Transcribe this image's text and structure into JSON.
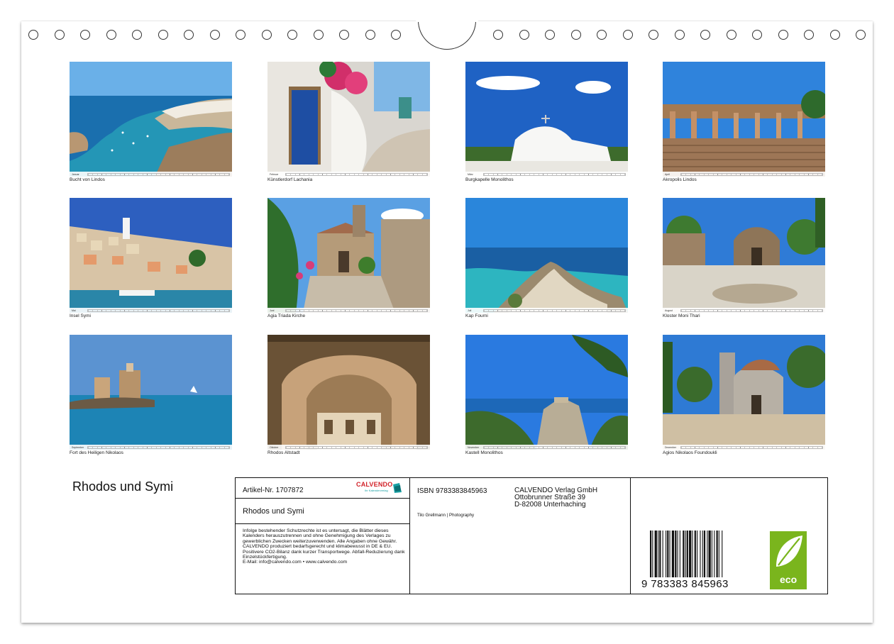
{
  "photos": [
    {
      "month": "Januar",
      "caption": "Bucht von Lindos",
      "icon": "bay-photo"
    },
    {
      "month": "Februar",
      "caption": "Künstlerdorf Lachania",
      "icon": "village-door-photo"
    },
    {
      "month": "März",
      "caption": "Burgkapelle Monolithos",
      "icon": "chapel-photo"
    },
    {
      "month": "April",
      "caption": "Akropolis Lindos",
      "icon": "acropolis-photo"
    },
    {
      "month": "Mai",
      "caption": "Insel Symi",
      "icon": "harbour-town-photo"
    },
    {
      "month": "Juni",
      "caption": "Agia Triada Kirche",
      "icon": "church-photo"
    },
    {
      "month": "Juli",
      "caption": "Kap Fourni",
      "icon": "cape-photo"
    },
    {
      "month": "August",
      "caption": "Kloster Moni Thari",
      "icon": "monastery-photo"
    },
    {
      "month": "September",
      "caption": "Fort des Heiligen Nikolaos",
      "icon": "fort-photo"
    },
    {
      "month": "Oktober",
      "caption": "Rhodos Altstadt",
      "icon": "arcade-photo"
    },
    {
      "month": "November",
      "caption": "Kastell Monolithos",
      "icon": "castle-cliff-photo"
    },
    {
      "month": "Dezember",
      "caption": "Agios Nikolaos Foundoukli",
      "icon": "byzantine-church-photo"
    }
  ],
  "calendar_title": "Rhodos und Symi",
  "info": {
    "article_no": "Artikel-Nr. 1707872",
    "publisher_logo": "CALVENDO",
    "publisher_logo_sub": "Ihr Kalenderverlag",
    "title": "Rhodos und Symi",
    "legal_text": "Infolge bestehender Schutzrechte ist es untersagt, die Blätter dieses Kalenders herauszutrennen und ohne Genehmigung des Verlages zu gewerblichen Zwecken weiterzuverwenden. Alle Angaben ohne Gewähr.\nCALVENDO produziert bedarfsgerecht und klimabewusst in DE & EU. Positivere CO2-Bilanz dank kurzer Transportwege. Abfall-Reduzierung dank Einzelstückfertigung.\nE-Mail: info@calvendo.com • www.calvendo.com",
    "isbn": "ISBN 9783383845963",
    "publisher_name": "CALVENDO Verlag GmbH",
    "publisher_street": "Ottobrunner Straße 39",
    "publisher_city": "D-82008 Unterhaching",
    "author": "Tilo Grellmann | Photography",
    "barcode_digits": "9 783383 845963",
    "eco_label": "eco"
  },
  "colors": {
    "sea": "#1f6fb0",
    "sky": "#3b8fd8",
    "eco_green": "#7ab51d",
    "calvendo_red": "#d2232a",
    "calvendo_teal": "#1aa0a4"
  }
}
